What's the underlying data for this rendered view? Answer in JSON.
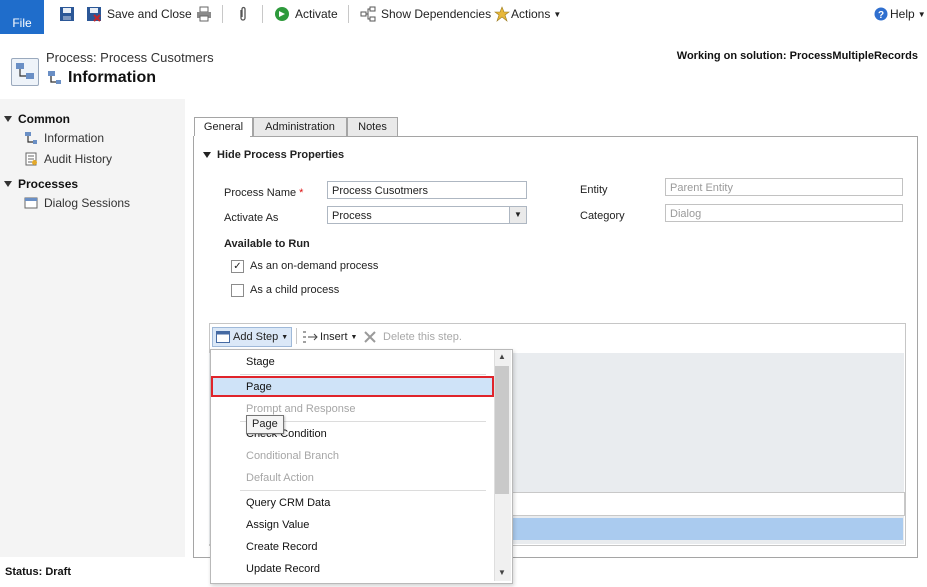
{
  "toolbar": {
    "file_label": "File",
    "save_close_label": "Save and Close",
    "activate_label": "Activate",
    "show_dependencies_label": "Show Dependencies",
    "actions_label": "Actions",
    "help_label": "Help"
  },
  "header": {
    "subtitle": "Process: Process Cusotmers",
    "title": "Information",
    "solution_text": "Working on solution: ProcessMultipleRecords"
  },
  "nav": {
    "common_label": "Common",
    "information_label": "Information",
    "audit_history_label": "Audit History",
    "processes_label": "Processes",
    "dialog_sessions_label": "Dialog Sessions"
  },
  "status": {
    "text": "Status: Draft"
  },
  "tabs": {
    "general": "General",
    "administration": "Administration",
    "notes": "Notes"
  },
  "form": {
    "section_title": "Hide Process Properties",
    "process_name_label": "Process Name",
    "required_mark": "*",
    "process_name_value": "Process Cusotmers",
    "activate_as_label": "Activate As",
    "activate_as_value": "Process",
    "entity_label": "Entity",
    "entity_value": "Parent Entity",
    "category_label": "Category",
    "category_value": "Dialog",
    "available_to_run_label": "Available to Run",
    "on_demand_label": "As an on-demand process",
    "on_demand_checked": true,
    "child_process_label": "As a child process",
    "child_process_checked": false
  },
  "steps_toolbar": {
    "add_step_label": "Add Step",
    "insert_label": "Insert",
    "delete_label": "Delete this step."
  },
  "add_step_menu": {
    "items": [
      {
        "label": "Stage",
        "enabled": true
      },
      {
        "label": "Page",
        "enabled": true,
        "highlighted": true
      },
      {
        "label": "Prompt and Response",
        "enabled": false
      },
      {
        "label": "Check Condition",
        "enabled": true
      },
      {
        "label": "Conditional Branch",
        "enabled": false
      },
      {
        "label": "Default Action",
        "enabled": false
      },
      {
        "label": "Query CRM Data",
        "enabled": true
      },
      {
        "label": "Assign Value",
        "enabled": true
      },
      {
        "label": "Create Record",
        "enabled": true
      },
      {
        "label": "Update Record",
        "enabled": true
      }
    ],
    "tooltip": "Page"
  },
  "colors": {
    "file_button": "#1f6dcb",
    "highlight_border": "#e0242b",
    "selected_row": "#aacbef"
  }
}
